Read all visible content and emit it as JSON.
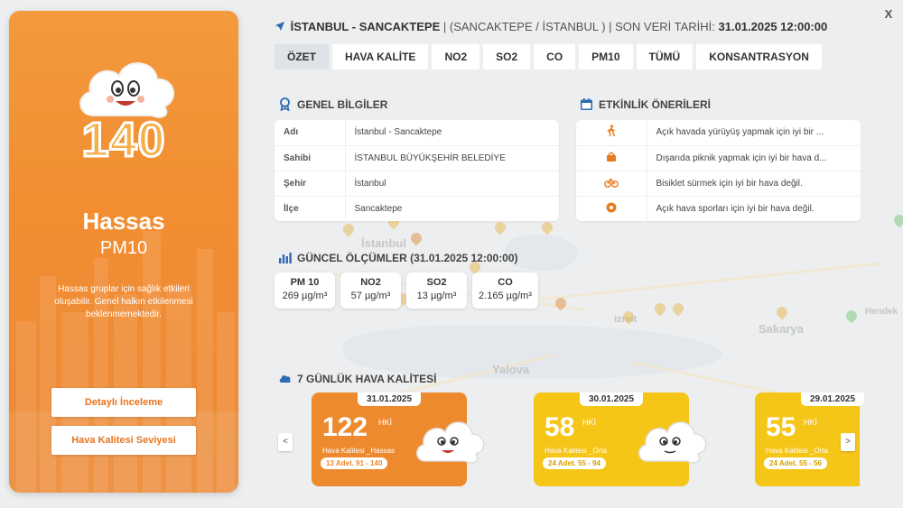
{
  "header": {
    "location": "İSTANBUL - SANCAKTEPE",
    "region": "| (SANCAKTEPE / İSTANBUL ) | SON VERİ TARİHİ: ",
    "last_date": "31.01.2025 12:00:00",
    "close_label": "X"
  },
  "tabs": [
    "ÖZET",
    "HAVA KALİTE",
    "NO2",
    "SO2",
    "CO",
    "PM10",
    "TÜMÜ",
    "KONSANTRASYON"
  ],
  "left_panel": {
    "aqi_value": "140",
    "title": "Hassas",
    "pollutant": "PM10",
    "description": "Hassas gruplar için sağlık etkileri oluşabilir. Genel halkın etkilenmesi beklenmemektedir.",
    "button_detail": "Detaylı İnceleme",
    "button_level": "Hava Kalitesi Seviyesi",
    "accent_color": "#f28d32"
  },
  "general_info": {
    "title": "GENEL BİLGİLER",
    "rows": [
      {
        "key": "Adı",
        "value": "İstanbul - Sancaktepe"
      },
      {
        "key": "Sahibi",
        "value": "İSTANBUL BÜYÜKŞEHİR BELEDİYE"
      },
      {
        "key": "Şehir",
        "value": "İstanbul"
      },
      {
        "key": "İlçe",
        "value": "Sancaktepe"
      }
    ]
  },
  "activities": {
    "title": "ETKİNLİK ÖNERİLERİ",
    "rows": [
      {
        "icon": "walking-icon",
        "text": "Açık havada yürüyüş yapmak için iyi bir ..."
      },
      {
        "icon": "picnic-icon",
        "text": "Dışarıda piknik yapmak için iyi bir hava d..."
      },
      {
        "icon": "bicycle-icon",
        "text": "Bisiklet sürmek için iyi bir hava değil."
      },
      {
        "icon": "sports-ball-icon",
        "text": "Açık hava sporları için iyi bir hava değil."
      }
    ]
  },
  "measurements": {
    "title": "GÜNCEL ÖLÇÜMLER (31.01.2025 12:00:00)",
    "items": [
      {
        "name": "PM 10",
        "value": "269 µg/m³"
      },
      {
        "name": "NO2",
        "value": "57 µg/m³"
      },
      {
        "name": "SO2",
        "value": "13 µg/m³"
      },
      {
        "name": "CO",
        "value": "2.165 µg/m³"
      }
    ]
  },
  "weekly": {
    "title": "7 GÜNLÜK HAVA KALİTESİ",
    "prev_label": "<",
    "next_label": ">",
    "days": [
      {
        "date": "31.01.2025",
        "value": "122",
        "unit": "HKİ",
        "category": "Hava Kalitesi _Hassas",
        "count": "13 Adet. 91 - 140",
        "color": "#ee8a2e"
      },
      {
        "date": "30.01.2025",
        "value": "58",
        "unit": "HKİ",
        "category": "Hava Kalitesi _Orta",
        "count": "24 Adet. 55 - 94",
        "color": "#f5c518"
      },
      {
        "date": "29.01.2025",
        "value": "55",
        "unit": "HKİ",
        "category": "Hava Kalitesi _Orta",
        "count": "24 Adet. 55 - 56",
        "color": "#f5c518"
      }
    ]
  },
  "map_labels": [
    "İstanbul",
    "Yalova",
    "Sakarya",
    "Hendek",
    "Izmit"
  ]
}
